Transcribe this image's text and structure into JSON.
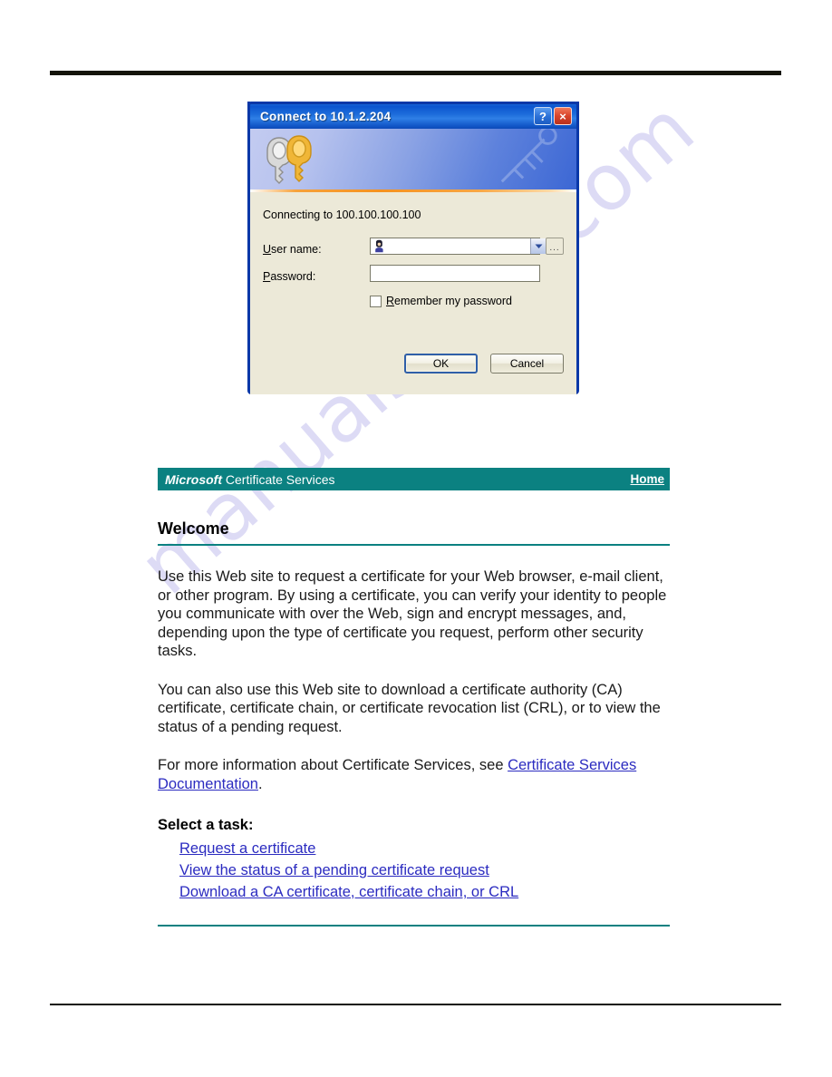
{
  "dialog": {
    "title": "Connect to 10.1.2.204",
    "help_button": "?",
    "close_button": "×",
    "connecting_text": "Connecting to 100.100.100.100",
    "username_label_accel": "U",
    "username_label_rest": "ser name:",
    "password_label_accel": "P",
    "password_label_rest": "assword:",
    "username_value": "",
    "password_value": "",
    "browse_button": "...",
    "remember_accel": "R",
    "remember_rest": "emember my password",
    "ok_button": "OK",
    "cancel_button": "Cancel",
    "icons": {
      "keys": "keys-icon",
      "user": "user-icon",
      "dropdown": "chevron-down-icon"
    },
    "colors": {
      "titlebar": "#0b55cf",
      "border": "#0a38a8",
      "body": "#ece9d8",
      "accent_rule": "#f59220"
    }
  },
  "cert_page": {
    "brand_bold": "Microsoft",
    "brand_rest": " Certificate Services",
    "home_link": "Home",
    "welcome_heading": "Welcome",
    "paragraph_1": "Use this Web site to request a certificate for your Web browser, e-mail client, or other program. By using a certificate, you can verify your identity to people you communicate with over the Web, sign and encrypt messages, and, depending upon the type of certificate you request, perform other security tasks.",
    "paragraph_2": "You can also use this Web site to download a certificate authority (CA) certificate, certificate chain, or certificate revocation list (CRL), or to view the status of a pending request.",
    "paragraph_3_prefix": "For more information about Certificate Services, see ",
    "documentation_link": "Certificate Services Documentation",
    "paragraph_3_suffix": ".",
    "select_task_heading": "Select a task:",
    "tasks": [
      {
        "label": "Request a certificate"
      },
      {
        "label": "View the status of a pending certificate request"
      },
      {
        "label": "Download a CA certificate, certificate chain, or CRL"
      }
    ],
    "colors": {
      "header_teal": "#0b8181",
      "link_blue": "#2b2bc0"
    }
  },
  "watermark": {
    "text": "manualshive.com",
    "color": "#c9c6ef"
  }
}
